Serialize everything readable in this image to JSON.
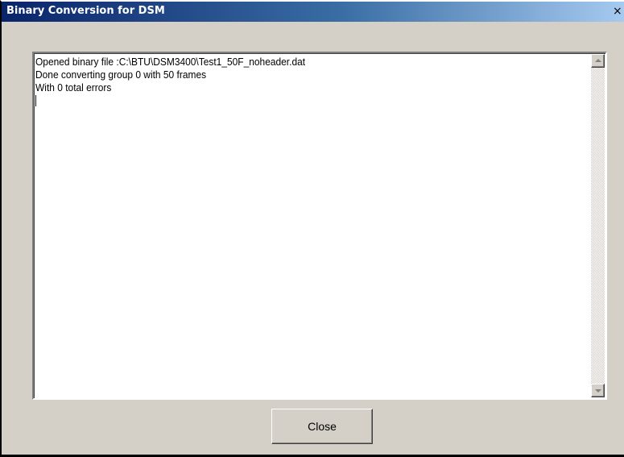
{
  "window": {
    "title": "Binary Conversion for DSM",
    "close_glyph": "×"
  },
  "output": {
    "lines": [
      "Opened binary file :C:\\BTU\\DSM3400\\Test1_50F_noheader.dat",
      "Done converting group 0 with 50 frames",
      "With 0 total errors"
    ]
  },
  "buttons": {
    "close_label": "Close"
  },
  "icons": {
    "scroll_up": "triangle-up-icon",
    "scroll_down": "triangle-down-icon",
    "title_close": "close-icon"
  },
  "colors": {
    "titlebar_start": "#0a246a",
    "titlebar_end": "#a6caf0",
    "face": "#d4d0c8"
  }
}
